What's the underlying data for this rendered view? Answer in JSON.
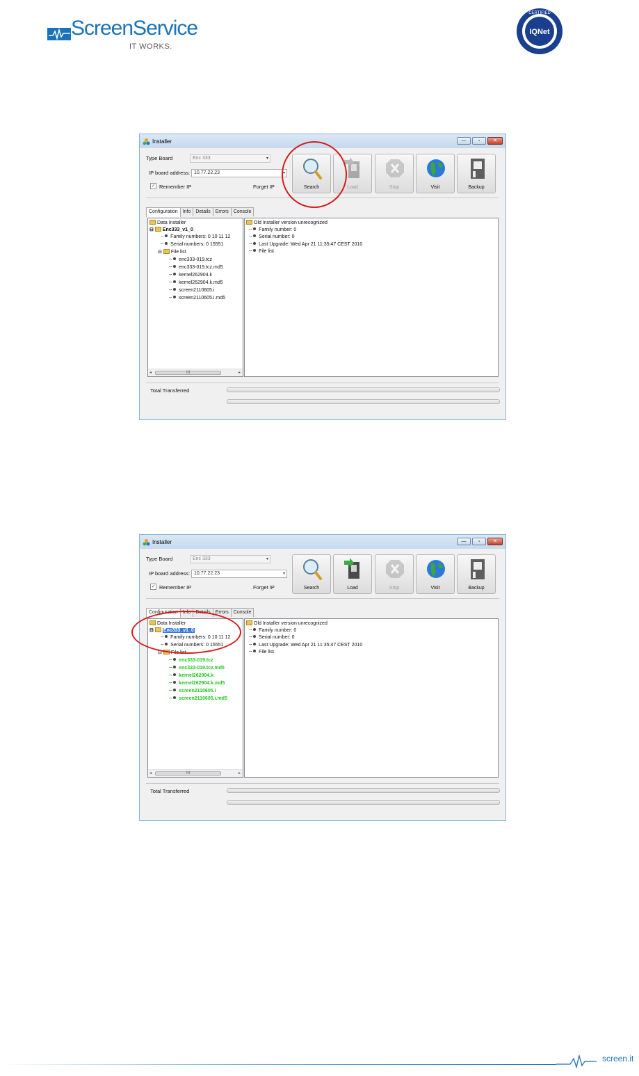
{
  "header": {
    "brand": "ScreenService",
    "tagline": "IT WORKS.",
    "cert_text": "IQNet"
  },
  "screens": [
    {
      "window_title": "Installer",
      "type_board_label": "Type Board",
      "type_board_value": "Enc 333",
      "ip_label": "IP board address:",
      "ip_value": "10.77.22.23",
      "remember_ip_label": "Remember IP",
      "remember_ip_checked": true,
      "forget_ip_label": "Forget IP",
      "buttons": [
        {
          "label": "Search",
          "enabled": true
        },
        {
          "label": "Load",
          "enabled": false
        },
        {
          "label": "Stop",
          "enabled": false
        },
        {
          "label": "Visit",
          "enabled": true
        },
        {
          "label": "Backup",
          "enabled": true
        }
      ],
      "tabs": [
        "Configuration",
        "Info",
        "Details",
        "Errors",
        "Console"
      ],
      "active_tab": "Configuration",
      "tree": {
        "root": "Data Installer",
        "board": "Enc333_v1_0",
        "family": "Family numbers:  0 10 11 12",
        "serial": "Serial numbers:  0 15551",
        "file_list": "File list",
        "files": [
          "enc333-019.tcz",
          "enc333-019.tcz.md5",
          "kernel262904.k",
          "kernel262904.k.md5",
          "screen2110605.i",
          "screen2110605.i.md5"
        ]
      },
      "detail": {
        "root": "Old Installer version unrecognized",
        "items": [
          "Family number: 0",
          "Serial number: 0",
          "Last Upgrade: Wed Apr 21 11:35:47 CEST 2010",
          "File list"
        ]
      },
      "total_label": "Total Transferred",
      "scroll_thumb": "III"
    },
    {
      "window_title": "Installer",
      "type_board_label": "Type Board",
      "type_board_value": "Enc 333",
      "ip_label": "IP board address:",
      "ip_value": "10.77.22.23",
      "remember_ip_label": "Remember IP",
      "remember_ip_checked": true,
      "forget_ip_label": "Forget IP",
      "buttons": [
        {
          "label": "Search",
          "enabled": true
        },
        {
          "label": "Load",
          "enabled": true
        },
        {
          "label": "Stop",
          "enabled": false
        },
        {
          "label": "Visit",
          "enabled": true
        },
        {
          "label": "Backup",
          "enabled": true
        }
      ],
      "tabs": [
        "Configuration",
        "Info",
        "Details",
        "Errors",
        "Console"
      ],
      "active_tab": "Configuration",
      "tree": {
        "root": "Data Installer",
        "board": "Enc333_v1_0",
        "family": "Family numbers:  0 10 11 12",
        "serial": "Serial numbers:  0 15551",
        "file_list": "File list",
        "files": [
          "enc333-019.tcz",
          "enc333-019.tcz.md5",
          "kernel262904.k",
          "kernel262904.k.md5",
          "screen2110605.i",
          "screen2110605.i.md5"
        ]
      },
      "detail": {
        "root": "Old Installer version unrecognized",
        "items": [
          "Family number: 0",
          "Serial number: 0",
          "Last Upgrade: Wed Apr 21 11:35:47 CEST 2010",
          "File list"
        ]
      },
      "total_label": "Total Transferred",
      "scroll_thumb": "III"
    }
  ],
  "footer": {
    "site": "screen.it"
  },
  "colors": {
    "brand_blue": "#1a72b8",
    "highlight_ring": "#d61a1a",
    "loaded_file_green": "#1ec71e",
    "selection_blue": "#3a7ad6"
  }
}
